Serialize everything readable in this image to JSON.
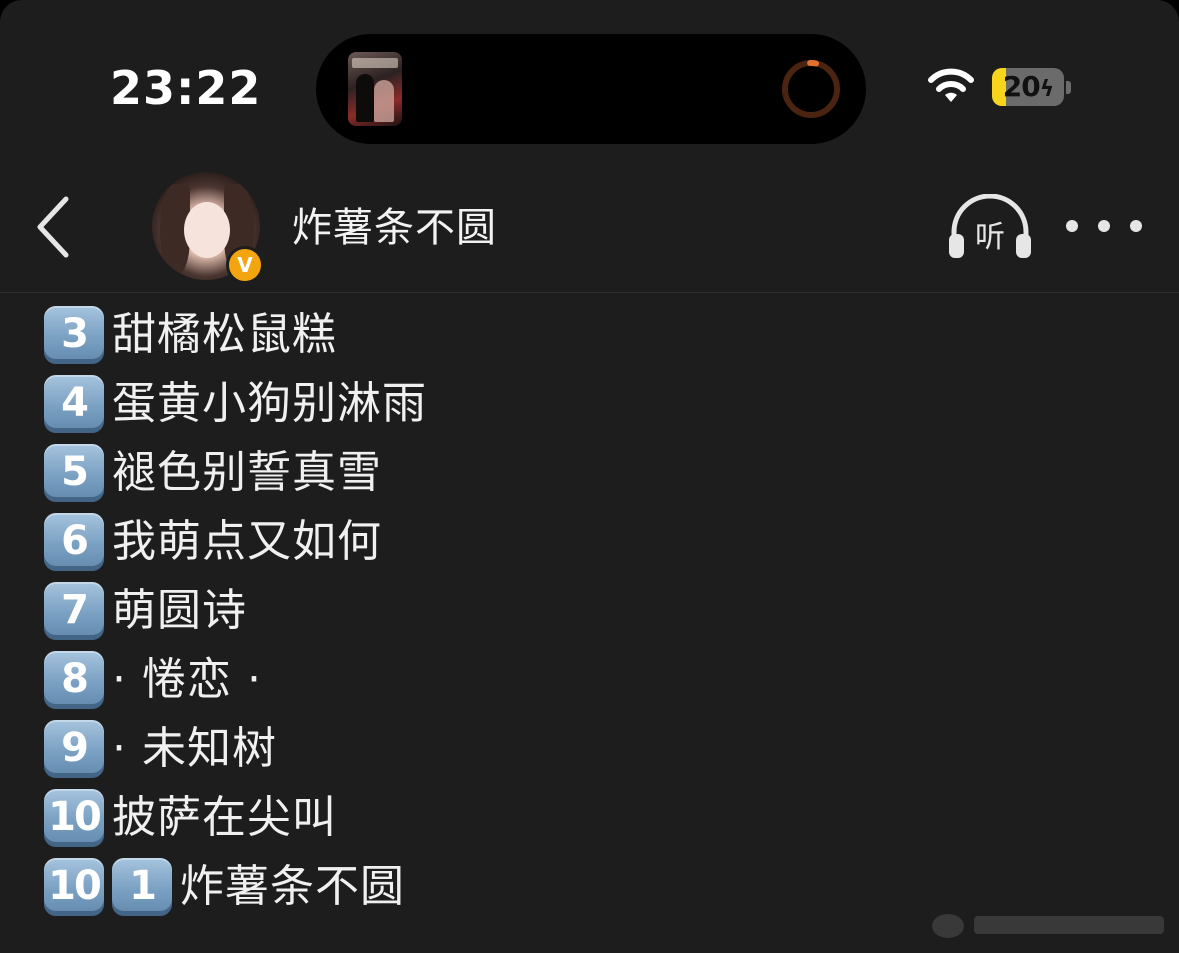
{
  "status_bar": {
    "time": "23:22",
    "battery_level": "20",
    "battery_charging": true,
    "battery_color": "#f7d51d"
  },
  "dynamic_island": {
    "activity": "now-playing-art",
    "ring_color": "#e07030"
  },
  "header": {
    "user_name": "炸薯条不圆",
    "verified_badge": "V",
    "listen_label": "听",
    "back_icon": "chevron-left-icon",
    "more_icon": "more-horizontal-icon"
  },
  "list": {
    "items": [
      {
        "badges": [
          "3"
        ],
        "text": "甜橘松鼠糕"
      },
      {
        "badges": [
          "4"
        ],
        "text": "蛋黄小狗别淋雨"
      },
      {
        "badges": [
          "5"
        ],
        "text": "褪色别誓真雪"
      },
      {
        "badges": [
          "6"
        ],
        "text": "我萌点又如何"
      },
      {
        "badges": [
          "7"
        ],
        "text": "萌圆诗"
      },
      {
        "badges": [
          "8"
        ],
        "text": "· 惓恋 ·"
      },
      {
        "badges": [
          "9"
        ],
        "text": "· 未知树"
      },
      {
        "badges": [
          "10"
        ],
        "text": "披萨在尖叫"
      },
      {
        "badges": [
          "10",
          "1"
        ],
        "text": "炸薯条不圆"
      }
    ]
  },
  "colors": {
    "background": "#1d1d1d",
    "text": "#f0f0f0",
    "keycap": "#7aa0c2",
    "verified": "#f3a50f"
  }
}
